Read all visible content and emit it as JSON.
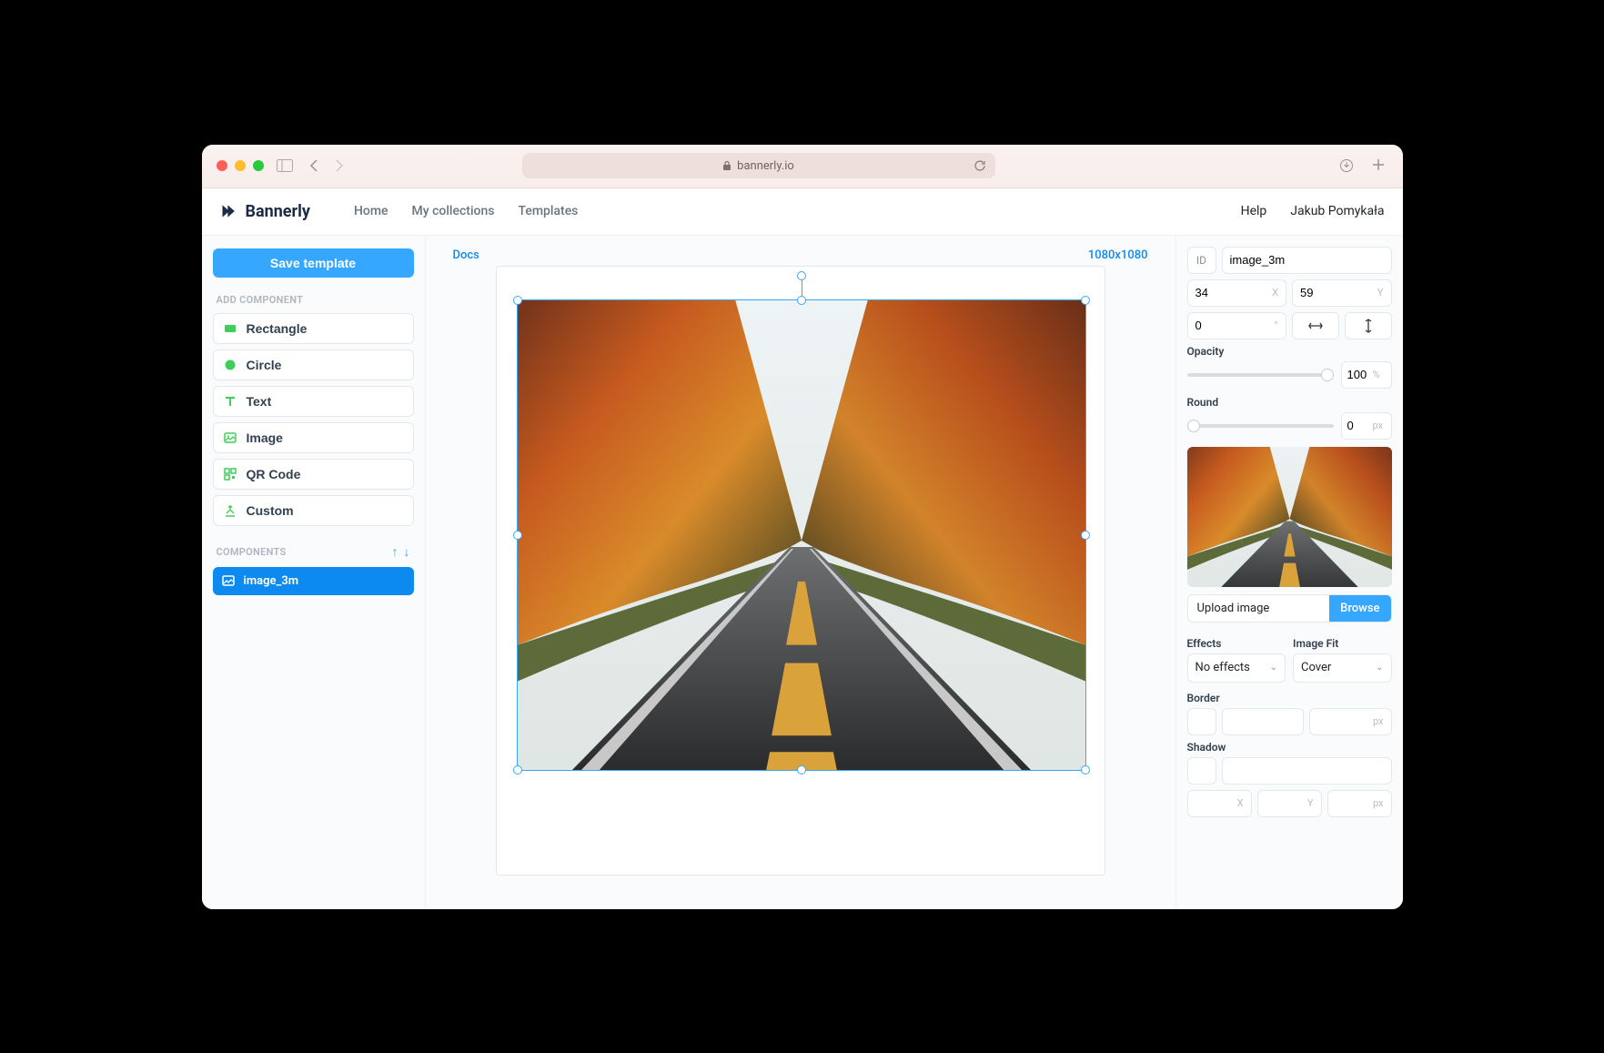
{
  "browser": {
    "url": "bannerly.io"
  },
  "brand": "Bannerly",
  "nav": {
    "home": "Home",
    "collections": "My collections",
    "templates": "Templates",
    "help": "Help",
    "user": "Jakub Pomykała"
  },
  "sidebar": {
    "save_label": "Save template",
    "add_title": "Add component",
    "rectangle": "Rectangle",
    "circle": "Circle",
    "text": "Text",
    "image": "Image",
    "qrcode": "QR Code",
    "custom": "Custom",
    "components_title": "Components",
    "layer0": "image_3m"
  },
  "canvas": {
    "breadcrumb": "Docs",
    "dimensions": "1080x1080"
  },
  "props": {
    "id_label": "ID",
    "id_value": "image_3m",
    "x": "34",
    "y": "59",
    "rotation": "0",
    "opacity_label": "Opacity",
    "opacity": "100",
    "opacity_unit": "%",
    "round_label": "Round",
    "round": "0",
    "round_unit": "px",
    "upload_label": "Upload image",
    "browse": "Browse",
    "effects_label": "Effects",
    "effects_value": "No effects",
    "fit_label": "Image Fit",
    "fit_value": "Cover",
    "border_label": "Border",
    "border_unit": "px",
    "shadow_label": "Shadow",
    "xyz_x": "X",
    "xyz_y": "Y",
    "xyz_px": "px"
  }
}
